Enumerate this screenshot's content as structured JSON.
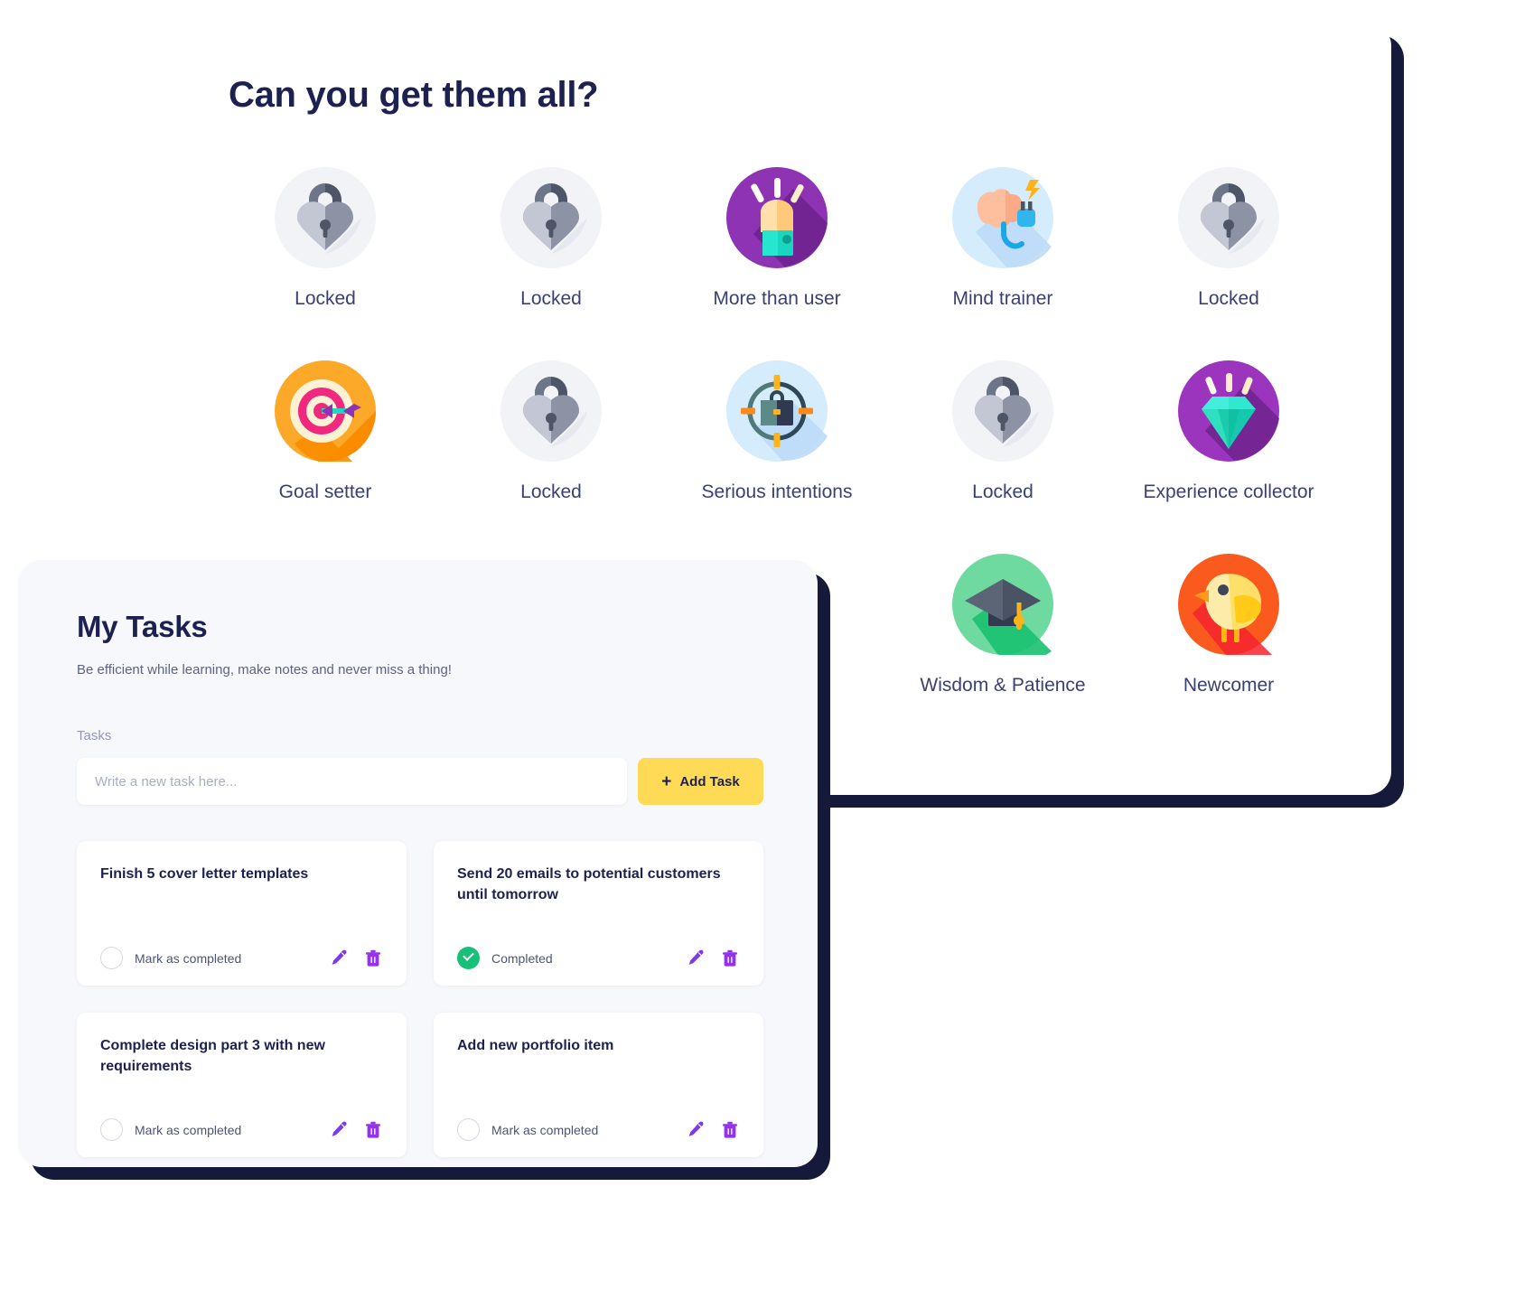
{
  "badges_panel": {
    "title": "Can you get them all?",
    "badges": [
      {
        "label": "Locked",
        "icon": "locked-padlock-icon"
      },
      {
        "label": "Locked",
        "icon": "locked-padlock-icon"
      },
      {
        "label": "More than user",
        "icon": "raised-fist-icon"
      },
      {
        "label": "Mind trainer",
        "icon": "brain-plug-icon"
      },
      {
        "label": "Locked",
        "icon": "locked-padlock-icon"
      },
      {
        "label": "Goal setter",
        "icon": "target-arrow-icon"
      },
      {
        "label": "Locked",
        "icon": "locked-padlock-icon"
      },
      {
        "label": "Serious intentions",
        "icon": "briefcase-crosshair-icon"
      },
      {
        "label": "Locked",
        "icon": "locked-padlock-icon"
      },
      {
        "label": "Experience collector",
        "icon": "diamond-icon"
      },
      {
        "label": "",
        "icon": "empty"
      },
      {
        "label": "",
        "icon": "empty"
      },
      {
        "label": "",
        "icon": "empty"
      },
      {
        "label": "Wisdom & Patience",
        "icon": "graduation-cap-icon"
      },
      {
        "label": "Newcomer",
        "icon": "chick-bird-icon"
      }
    ]
  },
  "tasks_panel": {
    "title": "My Tasks",
    "subtitle": "Be efficient while learning, make notes and never miss a thing!",
    "field_label": "Tasks",
    "input_placeholder": "Write a new task here...",
    "input_value": "",
    "add_button": {
      "plus": "+",
      "label": "Add Task"
    },
    "labels": {
      "mark_as_completed": "Mark as completed",
      "completed": "Completed"
    },
    "tasks": [
      {
        "text": "Finish 5 cover letter templates",
        "completed": false,
        "status_label": "Mark as completed"
      },
      {
        "text": "Send 20 emails to potential customers until tomorrow",
        "completed": true,
        "status_label": "Completed"
      },
      {
        "text": "Complete design part 3 with new requirements",
        "completed": false,
        "status_label": "Mark as completed"
      },
      {
        "text": "Add new portfolio item",
        "completed": false,
        "status_label": "Mark as completed"
      }
    ]
  },
  "colors": {
    "ink": "#1d2150",
    "accent_yellow": "#ffda57",
    "accent_purple": "#7c3aed",
    "success_green": "#16c076",
    "panel_bg": "#f7f8fc",
    "shadow": "#151a3a"
  }
}
